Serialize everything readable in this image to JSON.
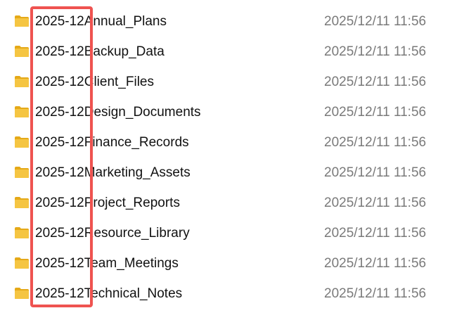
{
  "colors": {
    "folder": "#F5C542",
    "folder_dark": "#E5A918",
    "highlight": "#EF5350",
    "date_text": "#7A7A7A"
  },
  "files": [
    {
      "name": "2025-12Annual_Plans",
      "modified": "2025/12/11 11:56",
      "icon": "folder-icon"
    },
    {
      "name": "2025-12Backup_Data",
      "modified": "2025/12/11 11:56",
      "icon": "folder-icon"
    },
    {
      "name": "2025-12Client_Files",
      "modified": "2025/12/11 11:56",
      "icon": "folder-icon"
    },
    {
      "name": "2025-12Design_Documents",
      "modified": "2025/12/11 11:56",
      "icon": "folder-icon"
    },
    {
      "name": "2025-12Finance_Records",
      "modified": "2025/12/11 11:56",
      "icon": "folder-icon"
    },
    {
      "name": "2025-12Marketing_Assets",
      "modified": "2025/12/11 11:56",
      "icon": "folder-icon"
    },
    {
      "name": "2025-12Project_Reports",
      "modified": "2025/12/11 11:56",
      "icon": "folder-icon"
    },
    {
      "name": "2025-12Resource_Library",
      "modified": "2025/12/11 11:56",
      "icon": "folder-icon"
    },
    {
      "name": "2025-12Team_Meetings",
      "modified": "2025/12/11 11:56",
      "icon": "folder-icon"
    },
    {
      "name": "2025-12Technical_Notes",
      "modified": "2025/12/11 11:56",
      "icon": "folder-icon"
    }
  ]
}
